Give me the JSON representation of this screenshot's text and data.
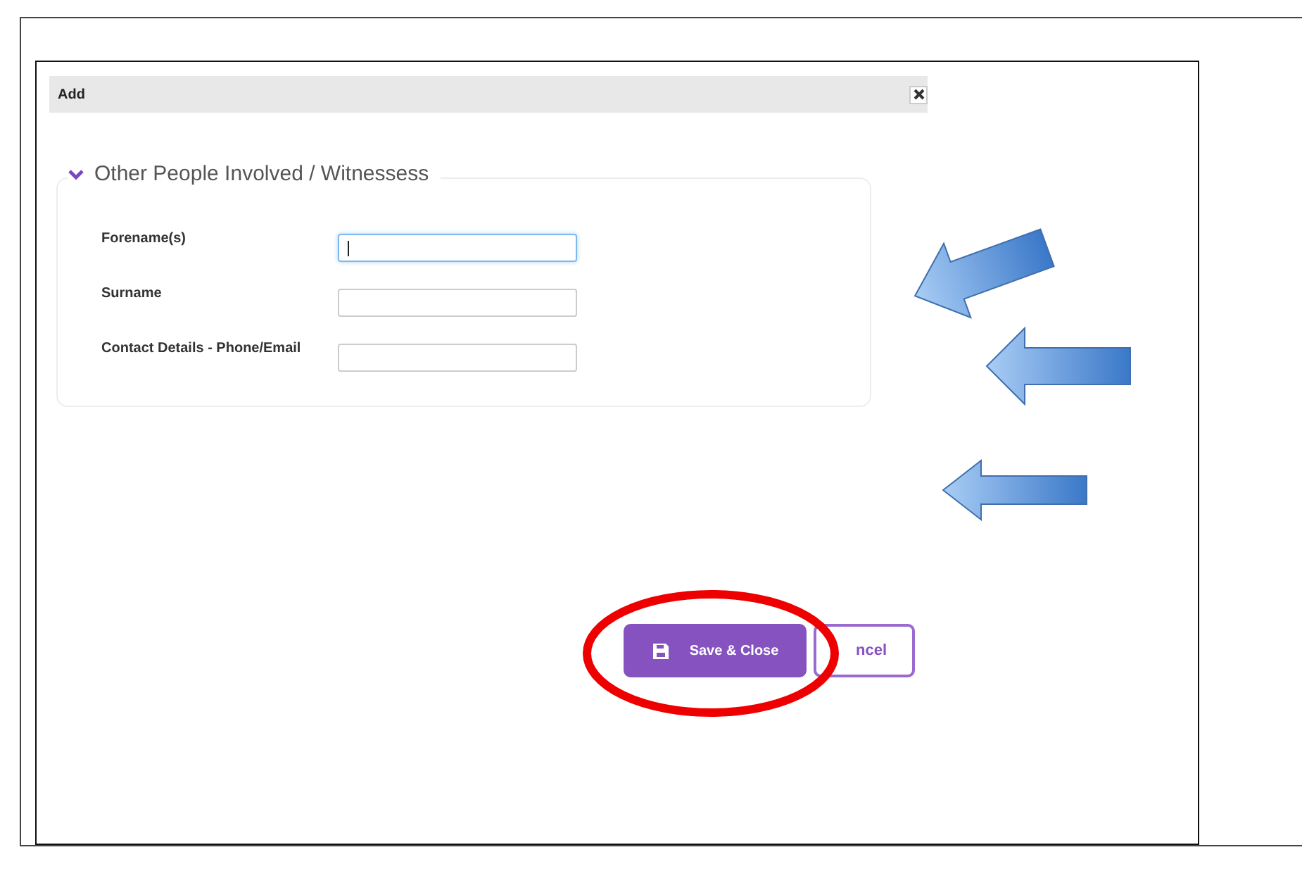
{
  "dialog": {
    "title": "Add"
  },
  "section": {
    "title": "Other People Involved / Witnessess",
    "expanded": true,
    "fields": [
      {
        "label": "Forename(s)",
        "focused": true
      },
      {
        "label": "Surname",
        "focused": false
      },
      {
        "label": "Contact Details - Phone/Email",
        "focused": false
      }
    ]
  },
  "buttons": [
    {
      "label": "Save & Close",
      "kind": "primary"
    },
    {
      "label": "ncel",
      "kind": "secondary"
    }
  ]
}
